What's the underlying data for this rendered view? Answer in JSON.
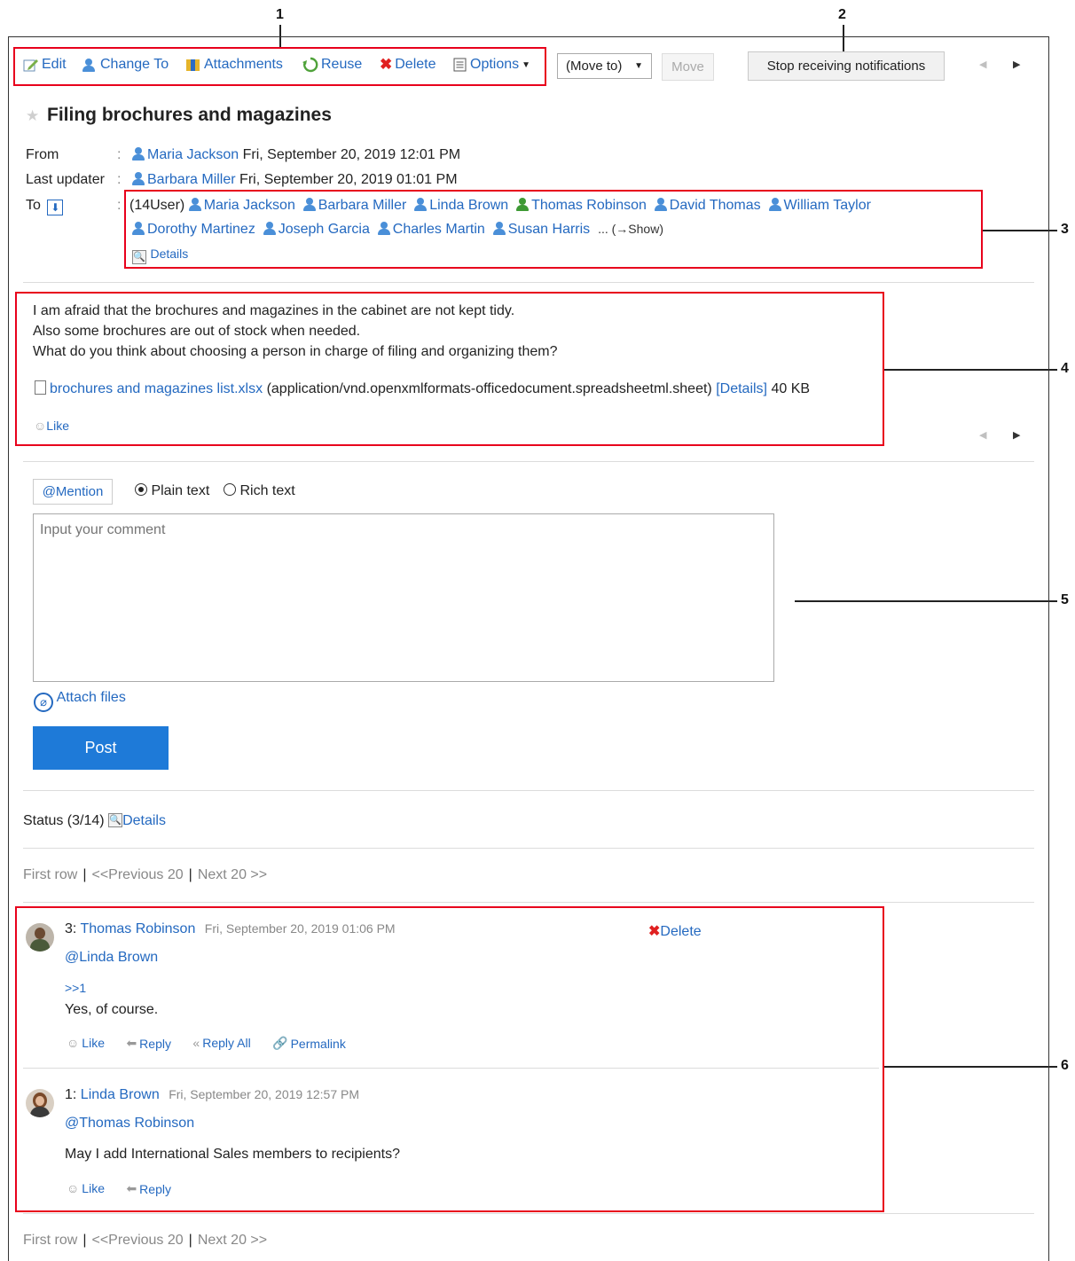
{
  "callouts": [
    "1",
    "2",
    "3",
    "4",
    "5",
    "6"
  ],
  "toolbar": {
    "edit": "Edit",
    "change_to": "Change To",
    "attachments": "Attachments",
    "reuse": "Reuse",
    "delete": "Delete",
    "options": "Options",
    "move_to_select": "(Move to)",
    "move_button": "Move",
    "stop_notifications": "Stop receiving notifications"
  },
  "message": {
    "title": "Filing brochures and magazines",
    "from_label": "From",
    "from_user": "Maria Jackson",
    "from_date": "Fri, September 20, 2019 12:01 PM",
    "updater_label": "Last updater",
    "updater_user": "Barbara Miller",
    "updater_date": "Fri, September 20, 2019 01:01 PM",
    "to_label": "To",
    "recipients_count": "(14User)",
    "recipients": [
      "Maria Jackson",
      "Barbara Miller",
      "Linda Brown",
      "Thomas Robinson",
      "David Thomas",
      "William Taylor",
      "Dorothy Martinez",
      "Joseph Garcia",
      "Charles Martin",
      "Susan Harris"
    ],
    "show_more": "... (→Show)",
    "details": "Details",
    "body": [
      "I am afraid that the brochures and magazines in the cabinet are not kept tidy.",
      "Also some brochures are out of stock when needed.",
      "What do you think about choosing a person in charge of filing and organizing them?"
    ],
    "attachment_name": "brochures and magazines list.xlsx",
    "attachment_type": "(application/vnd.openxmlformats-officedocument.spreadsheetml.sheet)",
    "attachment_details": "[Details]",
    "attachment_size": "40 KB",
    "like": "Like"
  },
  "comment_form": {
    "mention": "@Mention",
    "plain_text": "Plain text",
    "rich_text": "Rich text",
    "placeholder": "Input your comment",
    "attach_files": "Attach files",
    "post": "Post"
  },
  "status": {
    "label": "Status (3/14)",
    "details": "Details"
  },
  "pager": {
    "first": "First row",
    "prev": "<<Previous 20",
    "next": "Next 20 >>"
  },
  "comments": [
    {
      "number": "3:",
      "author": "Thomas Robinson",
      "date": "Fri, September 20, 2019 01:06 PM",
      "mention": "@Linda Brown",
      "quote": ">>1",
      "text": "Yes, of course.",
      "delete": "Delete",
      "actions": [
        "Like",
        "Reply",
        "Reply All",
        "Permalink"
      ]
    },
    {
      "number": "1:",
      "author": "Linda Brown",
      "date": "Fri, September 20, 2019 12:57 PM",
      "mention": "@Thomas Robinson",
      "text": "May I add International Sales members to recipients?",
      "actions": [
        "Like",
        "Reply"
      ]
    }
  ]
}
